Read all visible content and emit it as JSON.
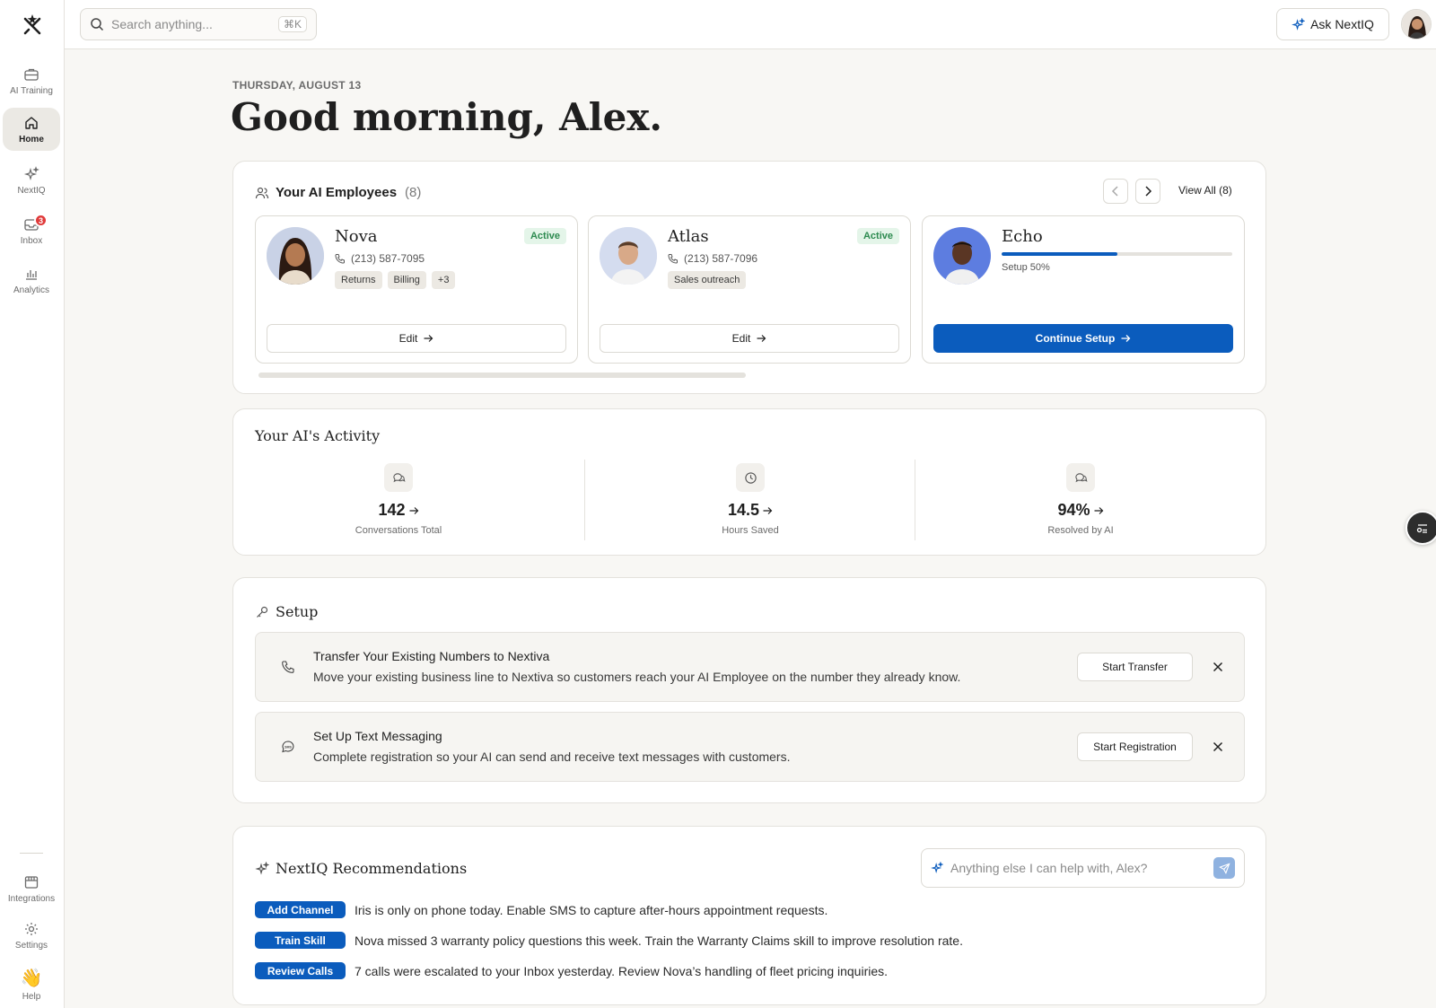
{
  "sidebar": {
    "items": [
      {
        "label": "AI Training",
        "icon": "briefcase-icon"
      },
      {
        "label": "Home",
        "icon": "home-icon"
      },
      {
        "label": "NextIQ",
        "icon": "sparkle-icon"
      },
      {
        "label": "Inbox",
        "icon": "inbox-icon",
        "badge": "3"
      },
      {
        "label": "Analytics",
        "icon": "bar-chart-icon"
      }
    ],
    "bottom": [
      {
        "label": "Integrations",
        "icon": "store-icon"
      },
      {
        "label": "Settings",
        "icon": "gear-icon"
      },
      {
        "label": "Help",
        "icon": "wave-hand-icon",
        "emoji": "👋"
      }
    ]
  },
  "topbar": {
    "search_placeholder": "Search anything...",
    "search_shortcut": "⌘K",
    "ask_label": "Ask NextIQ"
  },
  "header": {
    "date": "THURSDAY, AUGUST 13",
    "greeting": "Good morning, Alex."
  },
  "employees": {
    "title": "Your AI Employees",
    "count": "(8)",
    "view_all": "View All (8)",
    "items": [
      {
        "name": "Nova",
        "phone": "(213) 587-7095",
        "status": "Active",
        "tags": [
          "Returns",
          "Billing",
          "+3"
        ],
        "action": "Edit"
      },
      {
        "name": "Atlas",
        "phone": "(213) 587-7096",
        "status": "Active",
        "tags": [
          "Sales outreach"
        ],
        "action": "Edit"
      },
      {
        "name": "Echo",
        "progress": 0.5,
        "progress_label": "Setup 50%",
        "action": "Continue Setup"
      }
    ]
  },
  "activity": {
    "title": "Your AI's Activity",
    "metrics": [
      {
        "value": "142",
        "label": "Conversations Total",
        "icon": "chat-icon"
      },
      {
        "value": "14.5",
        "label": "Hours Saved",
        "icon": "clock-icon"
      },
      {
        "value": "94%",
        "label": "Resolved by AI",
        "icon": "chat-icon"
      }
    ]
  },
  "setup": {
    "title": "Setup",
    "tasks": [
      {
        "title": "Transfer Your Existing Numbers to Nextiva",
        "desc": "Move your existing business line to Nextiva so customers reach your AI Employee on the number they already know.",
        "button": "Start Transfer",
        "icon": "phone-icon"
      },
      {
        "title": "Set Up Text Messaging",
        "desc": "Complete registration so your AI can send and receive text messages with customers.",
        "button": "Start Registration",
        "icon": "sms-icon"
      }
    ]
  },
  "recommendations": {
    "title": "NextIQ Recommendations",
    "input_placeholder": "Anything else I can help with, Alex?",
    "items": [
      {
        "action": "Add Channel",
        "text": "Iris is only on phone today. Enable SMS to capture after-hours appointment requests."
      },
      {
        "action": "Train Skill",
        "text": "Nova missed 3 warranty policy questions this week. Train the Warranty Claims skill to improve resolution rate."
      },
      {
        "action": "Review Calls",
        "text": "7 calls were escalated to your Inbox yesterday. Review Nova’s handling of fleet pricing inquiries."
      }
    ]
  },
  "colors": {
    "accent": "#0b5cbd",
    "active_green": "#2c8a4f",
    "badge_red": "#e03a3a"
  }
}
